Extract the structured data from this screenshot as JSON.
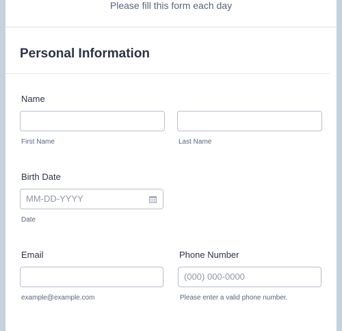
{
  "header": {
    "subtitle": "Please fill this form each day"
  },
  "section": {
    "title": "Personal Information"
  },
  "name": {
    "label": "Name",
    "first_sublabel": "First Name",
    "last_sublabel": "Last Name",
    "first_value": "",
    "last_value": ""
  },
  "birth_date": {
    "label": "Birth Date",
    "placeholder": "MM-DD-YYYY",
    "sublabel": "Date",
    "icon": "calendar-icon"
  },
  "email": {
    "label": "Email",
    "value": "",
    "sublabel": "example@example.com"
  },
  "phone": {
    "label": "Phone Number",
    "placeholder": "(000) 000-0000",
    "sublabel": "Please enter a valid phone number."
  },
  "colors": {
    "background": "#c5d1db",
    "card": "#ffffff",
    "text": "#2c3345",
    "muted": "#57647e",
    "border": "#b8bdc9"
  }
}
